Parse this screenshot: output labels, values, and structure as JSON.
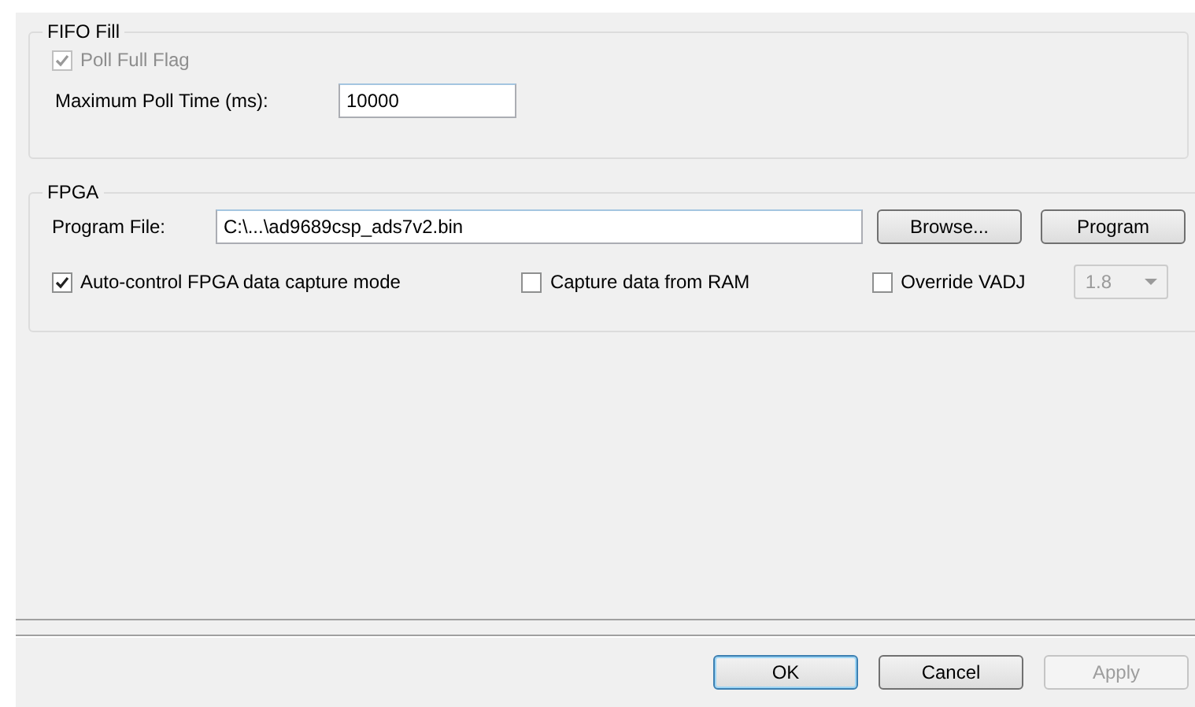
{
  "fifo_fill": {
    "title": "FIFO Fill",
    "poll_full_flag": {
      "label": "Poll Full Flag",
      "checked": true,
      "disabled": true
    },
    "max_poll_time": {
      "label": "Maximum Poll Time (ms):",
      "value": "10000"
    }
  },
  "fpga": {
    "title": "FPGA",
    "program_file": {
      "label": "Program File:",
      "value": "C:\\...\\ad9689csp_ads7v2.bin"
    },
    "buttons": [
      {
        "label": "Browse...",
        "disabled": false
      },
      {
        "label": "Program",
        "disabled": false
      }
    ],
    "options": [
      {
        "label": "Auto-control FPGA data capture mode",
        "checked": true
      },
      {
        "label": "Capture data from RAM",
        "checked": false
      },
      {
        "label": "Override VADJ",
        "checked": false
      }
    ],
    "vadj": {
      "value": "1.8",
      "disabled": true
    }
  },
  "footer_buttons": [
    {
      "label": "OK",
      "default": true,
      "disabled": false
    },
    {
      "label": "Cancel",
      "default": false,
      "disabled": false
    },
    {
      "label": "Apply",
      "default": false,
      "disabled": true
    }
  ]
}
